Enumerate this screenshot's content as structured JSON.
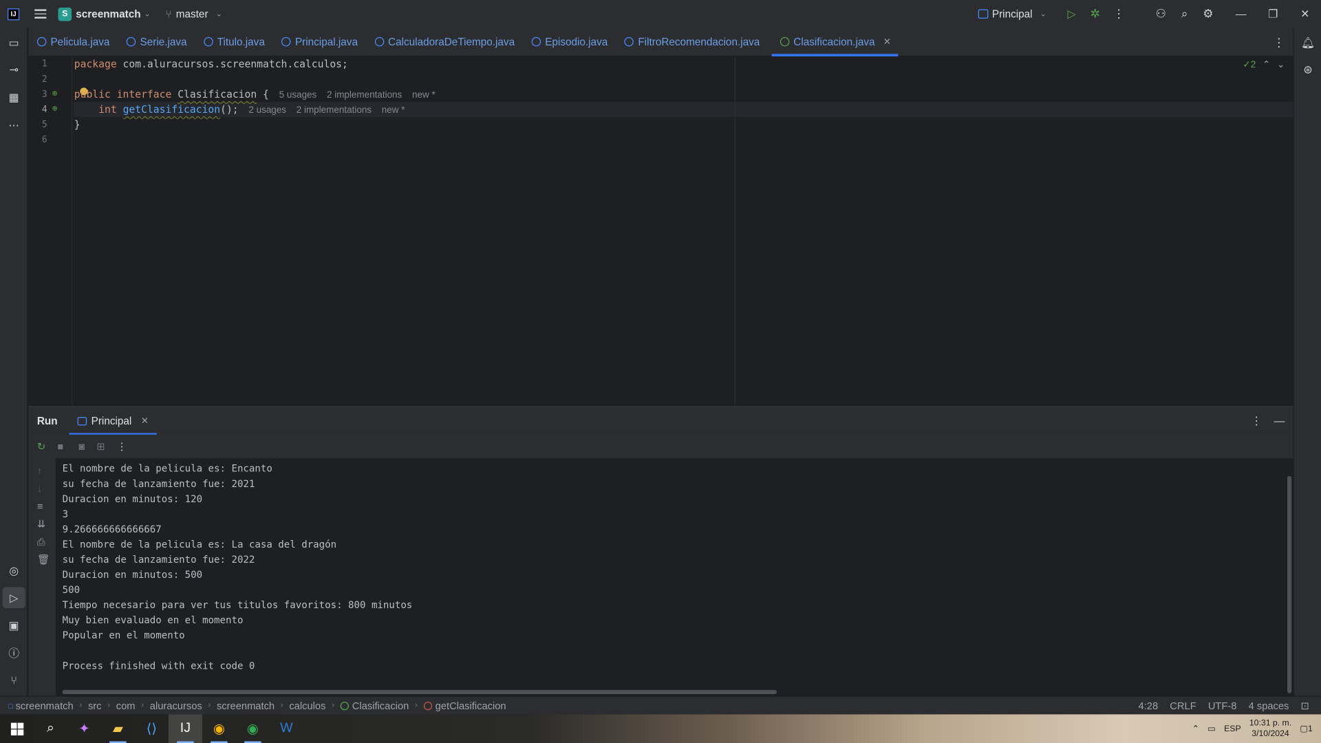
{
  "titlebar": {
    "project_initial": "S",
    "project_name": "screenmatch",
    "branch": "master",
    "run_config": "Principal"
  },
  "tabs": [
    {
      "label": "Pelicula.java",
      "kind": "class"
    },
    {
      "label": "Serie.java",
      "kind": "class"
    },
    {
      "label": "Titulo.java",
      "kind": "class"
    },
    {
      "label": "Principal.java",
      "kind": "class"
    },
    {
      "label": "CalculadoraDeTiempo.java",
      "kind": "class"
    },
    {
      "label": "Episodio.java",
      "kind": "class"
    },
    {
      "label": "FiltroRecomendacion.java",
      "kind": "class"
    },
    {
      "label": "Clasificacion.java",
      "kind": "interface",
      "active": true
    }
  ],
  "editor": {
    "line_numbers": [
      "1",
      "2",
      "3",
      "4",
      "5",
      "6"
    ],
    "line1": {
      "kw": "package",
      "rest": " com.aluracursos.screenmatch.calculos;"
    },
    "line3": {
      "kw1": "public",
      "kw2": "interface",
      "name": "Clasificacion",
      "brace": " {",
      "usages": "5 usages",
      "impls": "2 implementations",
      "new": "new *"
    },
    "line4": {
      "type": "int",
      "method": "getClasificacion",
      "rest": "();",
      "usages": "2 usages",
      "impls": "2 implementations",
      "new": "new *"
    },
    "line5": "}",
    "inspection_count": "2"
  },
  "run": {
    "title": "Run",
    "tab_label": "Principal",
    "output": [
      "El nombre de la pelicula es: Encanto",
      "su fecha de lanzamiento fue: 2021",
      "Duracion en minutos: 120",
      "3",
      "9.266666666666667",
      "El nombre de la pelicula es: La casa del dragón",
      "su fecha de lanzamiento fue: 2022",
      "Duracion en minutos: 500",
      "500",
      "Tiempo necesario para ver tus titulos favoritos: 800 minutos",
      "Muy bien evaluado en el momento",
      "Popular en el momento",
      "",
      "Process finished with exit code 0"
    ]
  },
  "statusbar": {
    "crumbs": [
      "screenmatch",
      "src",
      "com",
      "aluracursos",
      "screenmatch",
      "calculos"
    ],
    "crumb_interface": "Clasificacion",
    "crumb_method": "getClasificacion",
    "position": "4:28",
    "line_sep": "CRLF",
    "encoding": "UTF-8",
    "indent": "4 spaces"
  },
  "taskbar": {
    "time": "10:31 p. m.",
    "date": "3/10/2024",
    "lang": "ESP",
    "notif_count": "1"
  }
}
